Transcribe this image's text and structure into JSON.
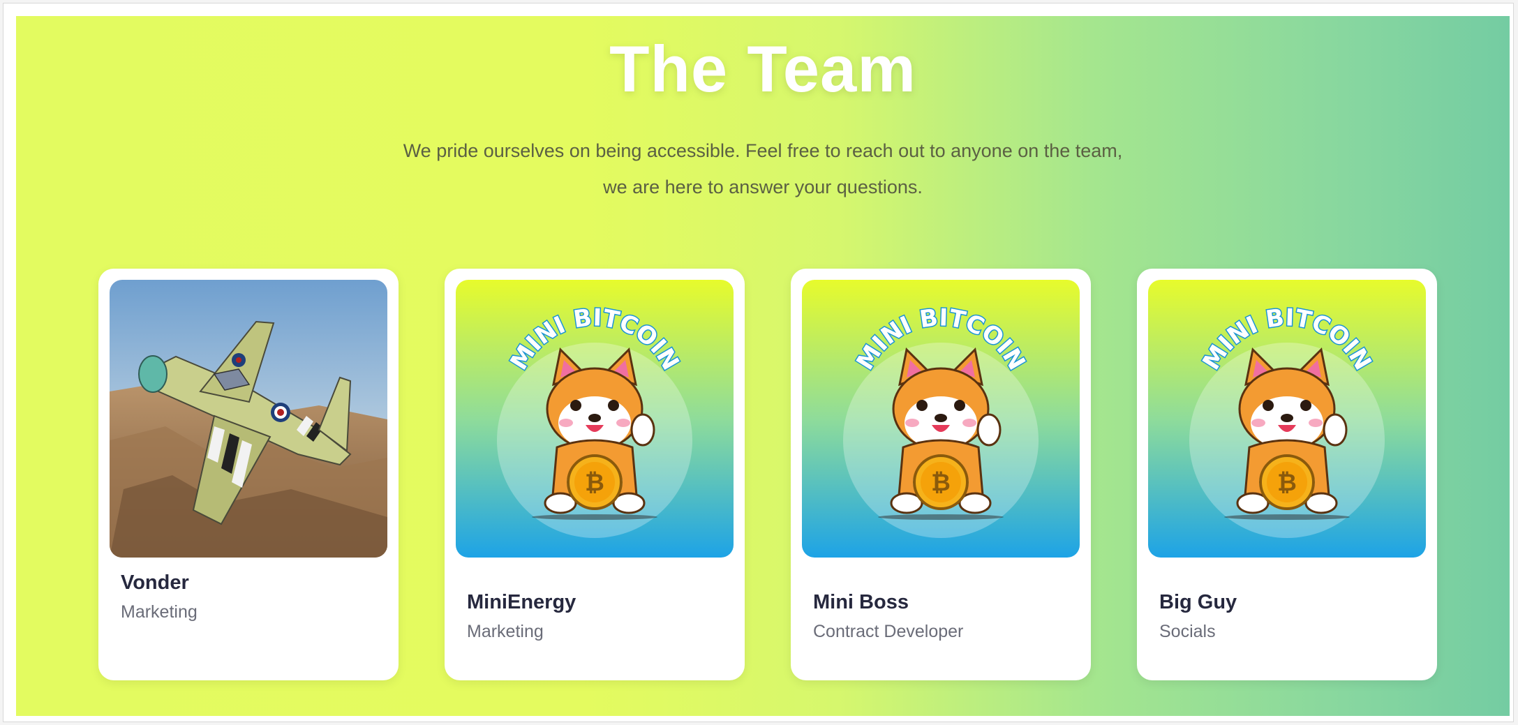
{
  "section": {
    "title": "The Team",
    "subtitle_line1": "We pride ourselves on being accessible. Feel free to reach out to anyone on the team,",
    "subtitle_line2": "we are here to answer your questions."
  },
  "members": [
    {
      "name": "Vonder",
      "role": "Marketing",
      "image": "fighter-plane-photo"
    },
    {
      "name": "MiniEnergy",
      "role": "Marketing",
      "image": "mini-bitcoin-logo"
    },
    {
      "name": "Mini Boss",
      "role": "Contract Developer",
      "image": "mini-bitcoin-logo"
    },
    {
      "name": "Big Guy",
      "role": "Socials",
      "image": "mini-bitcoin-logo"
    }
  ],
  "logo_text": "MINI BITCOIN",
  "colors": {
    "gradient_start": "#e3fb60",
    "gradient_end": "#74cca2",
    "card_background": "#ffffff",
    "name_text": "#26283e",
    "role_text": "#6a6c78",
    "logo_gradient_top": "#e7fb2c",
    "logo_gradient_bottom": "#1da3e6"
  }
}
